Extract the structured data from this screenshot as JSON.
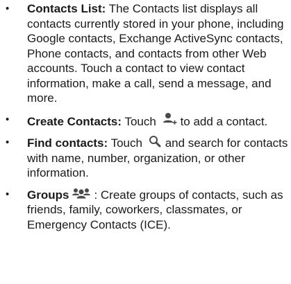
{
  "bullet_char": "•",
  "items": [
    {
      "term": "Contacts List:",
      "text": " The Contacts list displays all contacts currently stored in your phone, including Google contacts, Exchange ActiveSync contacts, Phone contacts, and contacts from other Web accounts. Touch a contact to view contact information, make a call, send a message, and more."
    },
    {
      "term": "Create Contacts:",
      "text_before": " Touch",
      "icon": "add-contact-icon",
      "text_after": "to add a contact."
    },
    {
      "term": "Find contacts:",
      "text_before": " Touch",
      "icon": "search-icon",
      "text_after": "and search for contacts with name, number, organization, or other information."
    },
    {
      "term": "Groups",
      "icon": "groups-icon",
      "text_after": ": Create groups of contacts, such as friends, family, coworkers, classmates, or Emergency Contacts (ICE)."
    }
  ],
  "colors": {
    "text": "#1a1a1a",
    "icon": "#4a4a4a",
    "background": "#ffffff"
  }
}
